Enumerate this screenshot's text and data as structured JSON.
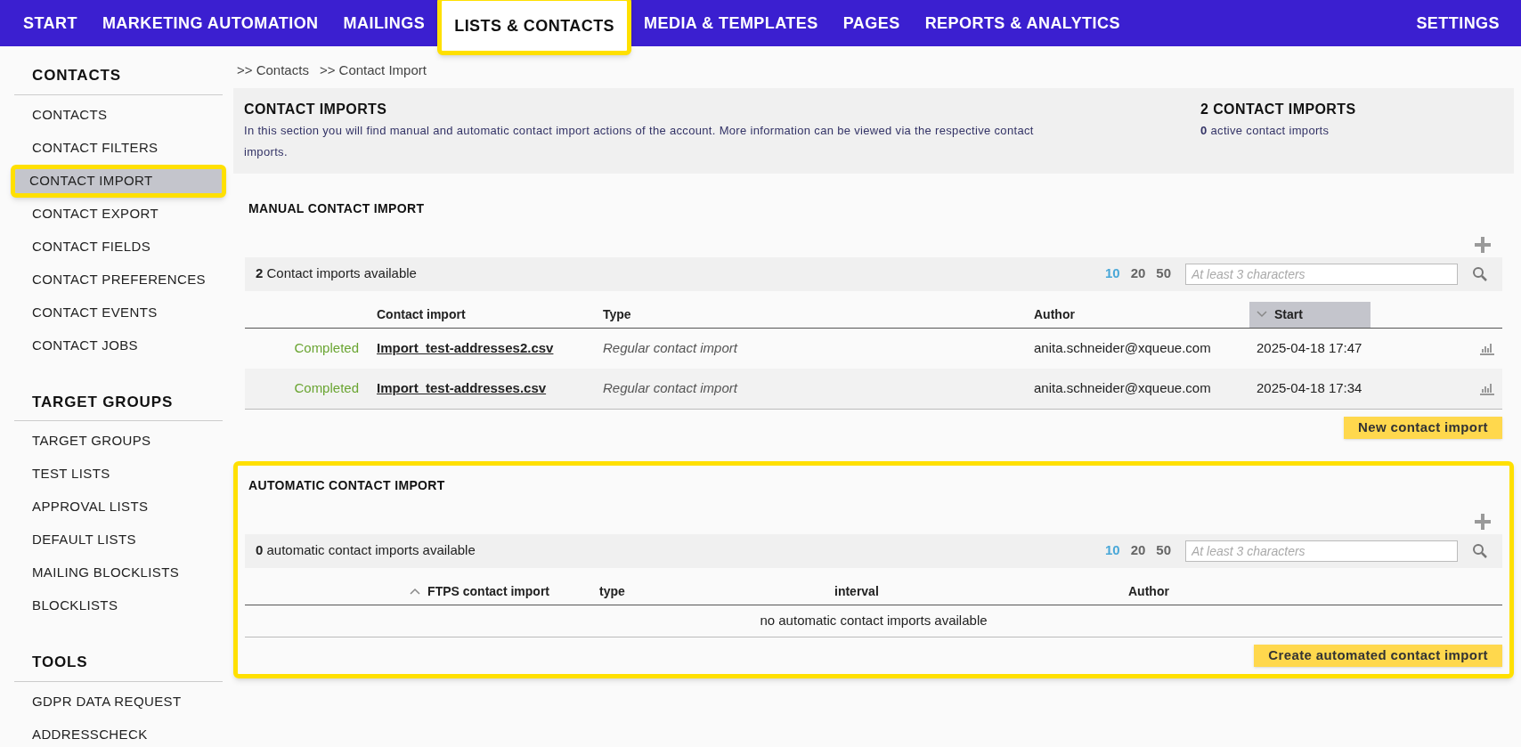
{
  "nav": {
    "items": [
      {
        "label": "START",
        "selected": false,
        "highlighted": false
      },
      {
        "label": "MARKETING AUTOMATION",
        "selected": false,
        "highlighted": false
      },
      {
        "label": "MAILINGS",
        "selected": false,
        "highlighted": false
      },
      {
        "label": "LISTS & CONTACTS",
        "selected": true,
        "highlighted": true
      },
      {
        "label": "MEDIA & TEMPLATES",
        "selected": false,
        "highlighted": false
      },
      {
        "label": "PAGES",
        "selected": false,
        "highlighted": false
      },
      {
        "label": "REPORTS & ANALYTICS",
        "selected": false,
        "highlighted": false
      }
    ],
    "settings": "SETTINGS"
  },
  "sidebar": {
    "groups": [
      {
        "title": "CONTACTS",
        "items": [
          {
            "label": "CONTACTS",
            "selected": false,
            "highlighted": false
          },
          {
            "label": "CONTACT FILTERS",
            "selected": false,
            "highlighted": false
          },
          {
            "label": "CONTACT IMPORT",
            "selected": true,
            "highlighted": true
          },
          {
            "label": "CONTACT EXPORT",
            "selected": false,
            "highlighted": false
          },
          {
            "label": "CONTACT FIELDS",
            "selected": false,
            "highlighted": false
          },
          {
            "label": "CONTACT PREFERENCES",
            "selected": false,
            "highlighted": false
          },
          {
            "label": "CONTACT EVENTS",
            "selected": false,
            "highlighted": false
          },
          {
            "label": "CONTACT JOBS",
            "selected": false,
            "highlighted": false
          }
        ]
      },
      {
        "title": "TARGET GROUPS",
        "items": [
          {
            "label": "TARGET GROUPS",
            "selected": false,
            "highlighted": false
          },
          {
            "label": "TEST LISTS",
            "selected": false,
            "highlighted": false
          },
          {
            "label": "APPROVAL LISTS",
            "selected": false,
            "highlighted": false
          },
          {
            "label": "DEFAULT LISTS",
            "selected": false,
            "highlighted": false
          },
          {
            "label": "MAILING BLOCKLISTS",
            "selected": false,
            "highlighted": false
          },
          {
            "label": "BLOCKLISTS",
            "selected": false,
            "highlighted": false
          }
        ]
      },
      {
        "title": "TOOLS",
        "items": [
          {
            "label": "GDPR DATA REQUEST",
            "selected": false,
            "highlighted": false
          },
          {
            "label": "ADDRESSCHECK",
            "selected": false,
            "highlighted": false
          }
        ]
      }
    ]
  },
  "breadcrumb": [
    ">> Contacts",
    ">> Contact Import"
  ],
  "info": {
    "title": "CONTACT IMPORTS",
    "text": "In this section you will find manual and automatic contact import actions of the account. More information can be viewed via the respective contact imports.",
    "count_title": "2 CONTACT IMPORTS",
    "count_text": "**0** active contact imports"
  },
  "sections": [
    {
      "title": "MANUAL CONTACT IMPORT",
      "highlighted": false,
      "available": "**2** Contact imports available",
      "page_sizes": [
        {
          "label": "10",
          "selected": true
        },
        {
          "label": "20",
          "selected": false
        },
        {
          "label": "50",
          "selected": false
        }
      ],
      "search": {
        "placeholder": "At least 3 characters"
      },
      "columns": [
        {
          "sort_up": false,
          "sort_down": false
        },
        {
          "label": "Contact import",
          "sort_up": false,
          "sort_down": false
        },
        {
          "label": "Type",
          "sort_up": false,
          "sort_down": false
        },
        {
          "label": "Author",
          "sort_up": false,
          "sort_down": false
        },
        {
          "label": "Start",
          "sort_up": false,
          "sort_down": true
        },
        {
          "sort_up": false,
          "sort_down": false
        }
      ],
      "rows": [
        {
          "status": "Completed",
          "name": "Import_test-addresses2.csv",
          "type": "Regular contact import",
          "author": "anita.schneider@xqueue.com",
          "start": "2025-04-18 17:47"
        },
        {
          "status": "Completed",
          "name": "Import_test-addresses.csv",
          "type": "Regular contact import",
          "author": "anita.schneider@xqueue.com",
          "start": "2025-04-18 17:34"
        }
      ],
      "button": "New contact import"
    },
    {
      "title": "AUTOMATIC CONTACT IMPORT",
      "highlighted": true,
      "available": "**0** automatic contact imports available",
      "page_sizes": [
        {
          "label": "10",
          "selected": true
        },
        {
          "label": "20",
          "selected": false
        },
        {
          "label": "50",
          "selected": false
        }
      ],
      "search": {
        "placeholder": "At least 3 characters"
      },
      "columns": [
        {
          "label": "FTPS contact import",
          "sort_up": true,
          "sort_down": false
        },
        {
          "label": "type",
          "sort_up": false,
          "sort_down": false
        },
        {
          "label": "interval",
          "sort_up": false,
          "sort_down": false
        },
        {
          "label": "Author",
          "sort_up": false,
          "sort_down": false
        }
      ],
      "empty": "no automatic contact imports available",
      "button": "Create automated contact import"
    }
  ]
}
